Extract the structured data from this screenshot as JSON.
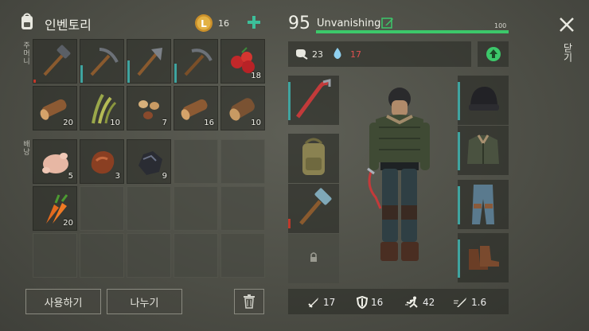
{
  "inventory": {
    "title": "인벤토리",
    "coins": "16",
    "pockets_label": "주머니",
    "backpack_label": "배낭",
    "pockets": [
      {
        "name": "hammer",
        "count": ""
      },
      {
        "name": "pickaxe",
        "count": ""
      },
      {
        "name": "hatchet",
        "count": ""
      },
      {
        "name": "pickaxe",
        "count": ""
      },
      {
        "name": "berries",
        "count": "18"
      },
      {
        "name": "log",
        "count": "20"
      },
      {
        "name": "fiber",
        "count": "10"
      },
      {
        "name": "seeds",
        "count": "7"
      },
      {
        "name": "log",
        "count": "16"
      },
      {
        "name": "log",
        "count": "10"
      }
    ],
    "backpack": [
      {
        "name": "raw-chicken",
        "count": "5"
      },
      {
        "name": "raw-meat",
        "count": "3"
      },
      {
        "name": "coal",
        "count": "9"
      },
      {
        "name": "carrots",
        "count": "20"
      }
    ],
    "use_label": "사용하기",
    "split_label": "나누기"
  },
  "player": {
    "level": "95",
    "name": "Unvanishing",
    "hp": "100",
    "hunger": "23",
    "thirst": "17"
  },
  "stats": {
    "attack": "17",
    "defense": "16",
    "speed": "42",
    "attack_speed": "1.6"
  },
  "close_label": "닫기",
  "colors": {
    "accent_green": "#3cc86a",
    "durability_teal": "#3fa4a0",
    "thirst_red": "#e05050",
    "coin_gold": "#d9a53a"
  }
}
